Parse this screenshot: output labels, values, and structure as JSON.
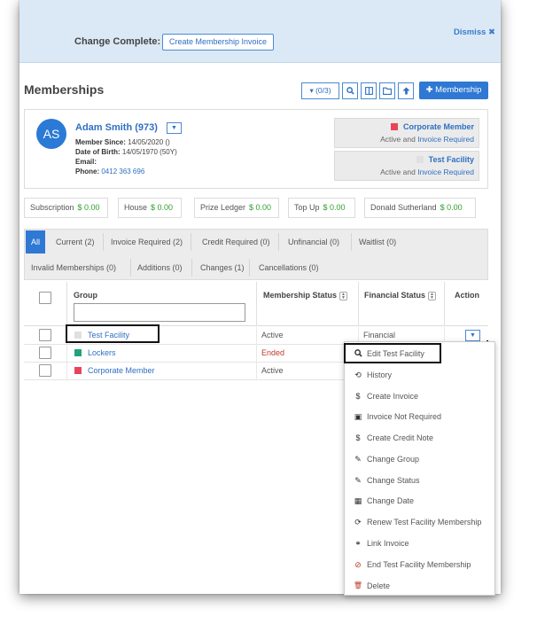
{
  "banner": {
    "label": "Change Complete:",
    "button": "Create Membership Invoice",
    "dismiss": "Dismiss ✖"
  },
  "page": {
    "title": "Memberships",
    "toolbar": {
      "filter": "▾ (0/3)",
      "search_icon": "search-icon",
      "columns_icon": "columns-icon",
      "folder_icon": "folder-icon",
      "up_icon": "arrow-up-icon",
      "add_membership": "✚ Membership"
    }
  },
  "member": {
    "initials": "AS",
    "name": "Adam Smith (973)",
    "since_label": "Member Since:",
    "since": "14/05/2020 ()",
    "dob_label": "Date of Birth:",
    "dob": "14/05/1970 (50Y)",
    "email_label": "Email:",
    "email": "",
    "phone_label": "Phone:",
    "phone": "0412 363 696",
    "groups": [
      {
        "name": "Corporate Member",
        "color": "#e8455a",
        "status": "Active and",
        "link": "Invoice Required"
      },
      {
        "name": "Test Facility",
        "color": "#e0e0e0",
        "status": "Active and",
        "link": "Invoice Required"
      }
    ]
  },
  "accounts": [
    {
      "label": "Subscription",
      "amount": "$ 0.00"
    },
    {
      "label": "House",
      "amount": "$ 0.00"
    },
    {
      "label": "Prize Ledger",
      "amount": "$ 0.00"
    },
    {
      "label": "Top Up",
      "amount": "$ 0.00"
    },
    {
      "label": "Donald Sutherland",
      "amount": "$ 0.00"
    }
  ],
  "tabs": [
    {
      "label": "All",
      "active": true
    },
    {
      "label": "Current (2)"
    },
    {
      "label": "Invoice Required (2)"
    },
    {
      "label": "Credit Required (0)"
    },
    {
      "label": "Unfinancial (0)"
    },
    {
      "label": "Waitlist (0)"
    },
    {
      "label": "Invalid Memberships (0)"
    },
    {
      "label": "Additions (0)"
    },
    {
      "label": "Changes (1)"
    },
    {
      "label": "Cancellations (0)"
    }
  ],
  "table": {
    "headers": {
      "group": "Group",
      "membership_status": "Membership Status",
      "financial_status": "Financial Status",
      "action": "Action"
    },
    "rows": [
      {
        "group": "Test Facility",
        "color": "#e0e0e0",
        "status": "Active",
        "financial": "Financial"
      },
      {
        "group": "Lockers",
        "color": "#1fa37a",
        "status": "Ended",
        "financial": ""
      },
      {
        "group": "Corporate Member",
        "color": "#e8455a",
        "status": "Active",
        "financial": ""
      }
    ]
  },
  "action_menu": [
    {
      "icon": "search-icon",
      "glyph": "🔍",
      "label": "Edit Test Facility"
    },
    {
      "icon": "history-icon",
      "glyph": "⟲",
      "label": "History"
    },
    {
      "icon": "dollar-icon",
      "glyph": "$",
      "label": "Create Invoice"
    },
    {
      "icon": "money-icon",
      "glyph": "▣",
      "label": "Invoice Not Required"
    },
    {
      "icon": "dollar-icon",
      "glyph": "$",
      "label": "Create Credit Note"
    },
    {
      "icon": "pencil-icon",
      "glyph": "✎",
      "label": "Change Group"
    },
    {
      "icon": "pencil-icon",
      "glyph": "✎",
      "label": "Change Status"
    },
    {
      "icon": "calendar-icon",
      "glyph": "▦",
      "label": "Change Date"
    },
    {
      "icon": "refresh-icon",
      "glyph": "⟳",
      "label": "Renew Test Facility Membership"
    },
    {
      "icon": "link-icon",
      "glyph": "⚭",
      "label": "Link Invoice"
    },
    {
      "icon": "ban-icon",
      "glyph": "⊘",
      "label": "End Test Facility Membership"
    },
    {
      "icon": "trash-icon",
      "glyph": "🗑",
      "label": "Delete"
    }
  ]
}
